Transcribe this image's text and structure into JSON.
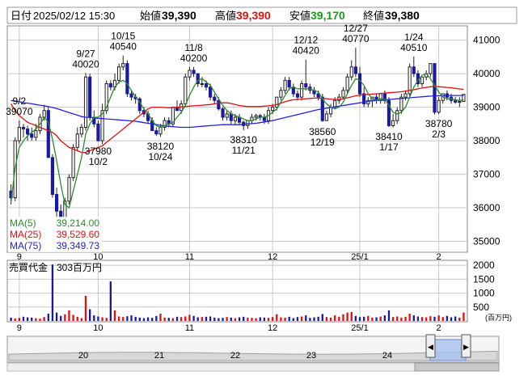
{
  "header": {
    "date_label": "日付",
    "datetime": "2025/02/12 15:30",
    "open_label": "始値",
    "open": "39,390",
    "high_label": "高値",
    "high": "39,390",
    "low_label": "安値",
    "low": "39,170",
    "close_label": "終値",
    "close": "39,380"
  },
  "colors": {
    "up": "#ffffff",
    "down": "#1a1aa0",
    "high_text": "#e01010",
    "low_text": "#1a9a1a",
    "ma5": "#2e8b2e",
    "ma25": "#e01010",
    "ma75": "#2222dd",
    "volume_up": "#e01010",
    "volume_down": "#1a1aa0",
    "grid": "#c8c8c8"
  },
  "legend": {
    "ma5_label": "MA(5)",
    "ma5_value": "39,214.00",
    "ma25_label": "MA(25)",
    "ma25_value": "39,529.60",
    "ma75_label": "MA(75)",
    "ma75_value": "39,349.73"
  },
  "volume_panel": {
    "label": "売買代金",
    "value": "303百万円",
    "unit": "(百万円)"
  },
  "navigator": {
    "labels": [
      "20",
      "21",
      "22",
      "23",
      "24"
    ]
  },
  "chart_data": {
    "type": "candlestick",
    "x": [
      "2024-08-29",
      "2024-08-30",
      "2024-09-02",
      "2024-09-03",
      "2024-09-04",
      "2024-09-05",
      "2024-09-06",
      "2024-09-09",
      "2024-09-10",
      "2024-09-11",
      "2024-09-12",
      "2024-09-13",
      "2024-09-17",
      "2024-09-18",
      "2024-09-19",
      "2024-09-20",
      "2024-09-24",
      "2024-09-25",
      "2024-09-26",
      "2024-09-27",
      "2024-09-30",
      "2024-10-01",
      "2024-10-02",
      "2024-10-03",
      "2024-10-04",
      "2024-10-07",
      "2024-10-08",
      "2024-10-09",
      "2024-10-10",
      "2024-10-11",
      "2024-10-15",
      "2024-10-16",
      "2024-10-17",
      "2024-10-18",
      "2024-10-21",
      "2024-10-22",
      "2024-10-23",
      "2024-10-24",
      "2024-10-25",
      "2024-10-28",
      "2024-10-29",
      "2024-10-30",
      "2024-10-31",
      "2024-11-01",
      "2024-11-05",
      "2024-11-06",
      "2024-11-07",
      "2024-11-08",
      "2024-11-11",
      "2024-11-12",
      "2024-11-13",
      "2024-11-14",
      "2024-11-15",
      "2024-11-18",
      "2024-11-19",
      "2024-11-20",
      "2024-11-21",
      "2024-11-22",
      "2024-11-25",
      "2024-11-26",
      "2024-11-27",
      "2024-11-28",
      "2024-11-29",
      "2024-12-02",
      "2024-12-03",
      "2024-12-04",
      "2024-12-05",
      "2024-12-06",
      "2024-12-09",
      "2024-12-10",
      "2024-12-11",
      "2024-12-12",
      "2024-12-13",
      "2024-12-16",
      "2024-12-17",
      "2024-12-18",
      "2024-12-19",
      "2024-12-20",
      "2024-12-23",
      "2024-12-24",
      "2024-12-25",
      "2024-12-26",
      "2024-12-27",
      "2024-12-30",
      "2025-01-06",
      "2025-01-07",
      "2025-01-08",
      "2025-01-09",
      "2025-01-10",
      "2025-01-14",
      "2025-01-15",
      "2025-01-16",
      "2025-01-17",
      "2025-01-20",
      "2025-01-21",
      "2025-01-22",
      "2025-01-23",
      "2025-01-24",
      "2025-01-27",
      "2025-01-28",
      "2025-01-29",
      "2025-01-30",
      "2025-01-31",
      "2025-02-03",
      "2025-02-04",
      "2025-02-05",
      "2025-02-06",
      "2025-02-07",
      "2025-02-10",
      "2025-02-12"
    ],
    "open": [
      36500,
      36300,
      38000,
      38400,
      38350,
      38200,
      38100,
      38300,
      38700,
      38900,
      37500,
      36400,
      35900,
      35700,
      36200,
      36900,
      37800,
      38200,
      38400,
      39900,
      38700,
      38500,
      38000,
      38900,
      39700,
      39600,
      39800,
      40200,
      40300,
      39400,
      39300,
      39250,
      38900,
      38800,
      38600,
      38300,
      38200,
      38400,
      38600,
      38500,
      39000,
      38900,
      39100,
      39900,
      40100,
      40000,
      39700,
      39700,
      39600,
      39300,
      39200,
      38950,
      38700,
      38800,
      38600,
      38700,
      38550,
      38450,
      38600,
      38700,
      38750,
      38700,
      38600,
      38900,
      39000,
      39300,
      39500,
      39800,
      39600,
      39400,
      39300,
      39700,
      39600,
      39500,
      39400,
      39300,
      38600,
      38800,
      39000,
      39200,
      39300,
      39500,
      39900,
      40200,
      40000,
      39400,
      39100,
      39200,
      39300,
      39200,
      39400,
      39200,
      38450,
      38600,
      38900,
      39300,
      39400,
      40200,
      40000,
      39700,
      39900,
      40000,
      40300,
      38850,
      39200,
      39400,
      39300,
      39200,
      39150,
      39170
    ],
    "high": [
      36700,
      38100,
      38600,
      38500,
      38450,
      38400,
      38500,
      38800,
      39070,
      39000,
      37600,
      36600,
      36100,
      36300,
      37000,
      37900,
      38400,
      38500,
      40020,
      40000,
      38900,
      38600,
      39100,
      39800,
      39800,
      40000,
      40300,
      40540,
      40400,
      39500,
      39400,
      39300,
      39000,
      38900,
      38700,
      38400,
      38500,
      38700,
      38700,
      39000,
      39200,
      39200,
      40000,
      40200,
      40200,
      40000,
      39900,
      39800,
      39700,
      39400,
      39300,
      39000,
      38900,
      38900,
      38800,
      38800,
      38600,
      38600,
      38800,
      38800,
      38800,
      38800,
      39000,
      39100,
      39300,
      39600,
      39900,
      39900,
      39700,
      39500,
      39800,
      40420,
      39700,
      39600,
      39500,
      39400,
      38900,
      39100,
      39300,
      39400,
      39600,
      40000,
      40400,
      40770,
      40200,
      39600,
      39300,
      39300,
      39400,
      39400,
      39500,
      39300,
      38800,
      39000,
      39400,
      39500,
      40300,
      40510,
      40100,
      39900,
      40100,
      40200,
      40300,
      39300,
      39300,
      39500,
      39400,
      39300,
      39300,
      39390
    ],
    "low": [
      36100,
      36200,
      37900,
      38100,
      38000,
      38000,
      38000,
      38200,
      38600,
      37500,
      36300,
      35700,
      35600,
      35600,
      36100,
      36800,
      37700,
      38100,
      38300,
      38600,
      38400,
      37980,
      37900,
      38800,
      39500,
      39500,
      39700,
      40100,
      39300,
      39200,
      39100,
      38800,
      38700,
      38500,
      38300,
      38150,
      38120,
      38300,
      38400,
      38400,
      38900,
      38800,
      39000,
      39800,
      39900,
      39600,
      39600,
      39500,
      39200,
      39100,
      38900,
      38600,
      38600,
      38500,
      38500,
      38500,
      38310,
      38350,
      38500,
      38600,
      38600,
      38500,
      38500,
      38800,
      38900,
      39200,
      39400,
      39500,
      39300,
      39200,
      39200,
      39500,
      39400,
      39300,
      39200,
      38560,
      38600,
      38700,
      38950,
      39100,
      39250,
      39400,
      39800,
      39900,
      39300,
      39000,
      39000,
      39000,
      39100,
      39100,
      39100,
      38410,
      38400,
      38500,
      38800,
      39200,
      39300,
      39900,
      39600,
      39600,
      39800,
      39900,
      38780,
      38800,
      39100,
      39200,
      39100,
      39100,
      39000,
      39170
    ],
    "close": [
      36300,
      38000,
      38400,
      38350,
      38200,
      38100,
      38300,
      38700,
      38900,
      37500,
      36400,
      35900,
      35700,
      36200,
      36900,
      37800,
      38200,
      38400,
      39900,
      38700,
      38500,
      38000,
      38900,
      39700,
      39600,
      39800,
      40200,
      40300,
      39400,
      39300,
      39250,
      38900,
      38800,
      38600,
      38300,
      38200,
      38400,
      38600,
      38500,
      39000,
      38900,
      39100,
      39900,
      40100,
      40000,
      39700,
      39700,
      39600,
      39300,
      39200,
      38950,
      38700,
      38800,
      38600,
      38700,
      38550,
      38450,
      38600,
      38700,
      38750,
      38700,
      38600,
      38900,
      39000,
      39300,
      39500,
      39800,
      39600,
      39400,
      39300,
      39700,
      39600,
      39500,
      39400,
      39300,
      38600,
      38800,
      39000,
      39200,
      39300,
      39500,
      39900,
      40200,
      40000,
      39400,
      39100,
      39200,
      39300,
      39200,
      39400,
      39200,
      38450,
      38600,
      38900,
      39300,
      39400,
      40200,
      40000,
      39700,
      39900,
      40000,
      40300,
      38850,
      39200,
      39400,
      39300,
      39200,
      39150,
      39170,
      39380
    ],
    "volume": [
      120,
      90,
      110,
      150,
      130,
      120,
      100,
      80,
      140,
      260,
      2030,
      300,
      180,
      240,
      380,
      220,
      150,
      100,
      900,
      420,
      200,
      160,
      130,
      110,
      1420,
      380,
      160,
      140,
      170,
      200,
      150,
      120,
      100,
      130,
      110,
      180,
      260,
      120,
      110,
      100,
      150,
      140,
      160,
      220,
      180,
      130,
      140,
      150,
      160,
      120,
      100,
      110,
      140,
      120,
      100,
      130,
      150,
      120,
      110,
      100,
      130,
      120,
      110,
      140,
      240,
      130,
      120,
      150,
      100,
      140,
      160,
      200,
      110,
      130,
      150,
      250,
      140,
      120,
      200,
      150,
      240,
      300,
      320,
      180,
      140,
      150,
      180,
      120,
      130,
      160,
      200,
      380,
      140,
      160,
      120,
      150,
      260,
      200,
      160,
      140,
      130,
      170,
      150,
      200,
      140,
      180,
      130,
      160,
      120,
      303
    ],
    "ma5": [
      36150,
      37200,
      37800,
      38000,
      38150,
      38250,
      38350,
      38500,
      38700,
      38550,
      38050,
      37400,
      36700,
      36100,
      36000,
      36500,
      37000,
      37500,
      38200,
      38500,
      38700,
      38700,
      38800,
      39000,
      39300,
      39600,
      39750,
      39800,
      39700,
      39500,
      39300,
      39150,
      38950,
      38800,
      38600,
      38450,
      38400,
      38450,
      38500,
      38550,
      38700,
      38850,
      39050,
      39350,
      39600,
      39800,
      39850,
      39750,
      39650,
      39450,
      39250,
      39050,
      38900,
      38800,
      38750,
      38700,
      38650,
      38600,
      38600,
      38650,
      38700,
      38700,
      38750,
      38850,
      38950,
      39150,
      39350,
      39550,
      39600,
      39550,
      39550,
      39550,
      39550,
      39500,
      39450,
      39250,
      39100,
      39000,
      38950,
      39000,
      39150,
      39400,
      39650,
      39850,
      39800,
      39650,
      39400,
      39250,
      39200,
      39250,
      39250,
      39050,
      38850,
      38800,
      38850,
      39000,
      39300,
      39600,
      39800,
      39950,
      40000,
      39850,
      39650,
      39450,
      39300,
      39250,
      39250,
      39220,
      39200,
      39214
    ],
    "ma25": [
      39100,
      38900,
      38750,
      38650,
      38550,
      38500,
      38450,
      38400,
      38350,
      38300,
      38250,
      38150,
      38000,
      37900,
      37800,
      37750,
      37700,
      37650,
      37650,
      37700,
      37750,
      37800,
      37850,
      37950,
      38050,
      38150,
      38250,
      38350,
      38450,
      38550,
      38650,
      38750,
      38850,
      38950,
      39000,
      39000,
      39000,
      38990,
      38980,
      38990,
      39000,
      39010,
      39020,
      39030,
      39040,
      39050,
      39060,
      39070,
      39080,
      39100,
      39120,
      39130,
      39130,
      39110,
      39080,
      39050,
      39030,
      39020,
      39020,
      39020,
      39020,
      39030,
      39040,
      39050,
      39080,
      39120,
      39160,
      39200,
      39220,
      39230,
      39240,
      39250,
      39260,
      39270,
      39270,
      39260,
      39250,
      39240,
      39230,
      39230,
      39250,
      39280,
      39310,
      39340,
      39360,
      39370,
      39380,
      39390,
      39400,
      39410,
      39420,
      39430,
      39440,
      39450,
      39460,
      39480,
      39500,
      39520,
      39550,
      39570,
      39590,
      39610,
      39620,
      39610,
      39600,
      39590,
      39580,
      39560,
      39545,
      39530
    ],
    "ma75": [
      39200,
      39180,
      39160,
      39140,
      39120,
      39100,
      39080,
      39060,
      39040,
      39020,
      38990,
      38960,
      38920,
      38880,
      38840,
      38800,
      38760,
      38720,
      38700,
      38690,
      38680,
      38670,
      38660,
      38650,
      38640,
      38630,
      38620,
      38610,
      38600,
      38590,
      38580,
      38560,
      38540,
      38520,
      38500,
      38480,
      38460,
      38440,
      38430,
      38420,
      38410,
      38400,
      38400,
      38400,
      38410,
      38420,
      38430,
      38440,
      38450,
      38460,
      38470,
      38480,
      38480,
      38480,
      38480,
      38480,
      38490,
      38500,
      38510,
      38520,
      38540,
      38560,
      38580,
      38600,
      38630,
      38660,
      38690,
      38720,
      38750,
      38780,
      38810,
      38840,
      38870,
      38900,
      38930,
      38950,
      38970,
      38990,
      39010,
      39030,
      39050,
      39070,
      39090,
      39110,
      39130,
      39150,
      39170,
      39190,
      39200,
      39210,
      39220,
      39230,
      39240,
      39250,
      39260,
      39270,
      39280,
      39290,
      39300,
      39310,
      39320,
      39330,
      39340,
      39340,
      39345,
      39348,
      39350,
      39350,
      39350,
      39349.73
    ],
    "annotations": [
      {
        "x": "2024-09-02",
        "date": "9/2",
        "value": "39070",
        "position": "above"
      },
      {
        "x": "2024-09-26",
        "date": "9/27",
        "value": "40020",
        "position": "above"
      },
      {
        "x": "2024-10-01",
        "date": "10/2",
        "value": "37980",
        "position": "below"
      },
      {
        "x": "2024-10-09",
        "date": "10/15",
        "value": "40540",
        "position": "above"
      },
      {
        "x": "2024-10-23",
        "date": "10/24",
        "value": "38120",
        "position": "below"
      },
      {
        "x": "2024-11-05",
        "date": "11/8",
        "value": "40200",
        "position": "above"
      },
      {
        "x": "2024-11-21",
        "date": "11/21",
        "value": "38310",
        "position": "below"
      },
      {
        "x": "2024-12-12",
        "date": "12/12",
        "value": "40420",
        "position": "above"
      },
      {
        "x": "2024-12-18",
        "date": "12/19",
        "value": "38560",
        "position": "below"
      },
      {
        "x": "2024-12-30",
        "date": "12/27",
        "value": "40770",
        "position": "above"
      },
      {
        "x": "2025-01-16",
        "date": "1/17",
        "value": "38410",
        "position": "below"
      },
      {
        "x": "2025-01-24",
        "date": "1/24",
        "value": "40510",
        "position": "above"
      },
      {
        "x": "2025-02-03",
        "date": "2/3",
        "value": "38780",
        "position": "below"
      }
    ],
    "x_tick_labels": [
      {
        "x": "2024-09-02",
        "label": "9"
      },
      {
        "x": "2024-10-01",
        "label": "10"
      },
      {
        "x": "2024-11-01",
        "label": "11"
      },
      {
        "x": "2024-12-02",
        "label": "12"
      },
      {
        "x": "2025-01-06",
        "label": "25/1"
      },
      {
        "x": "2025-02-03",
        "label": "2"
      }
    ],
    "y_ticks": [
      35000,
      36000,
      37000,
      38000,
      39000,
      40000,
      41000
    ],
    "ylim": [
      34700,
      41400
    ],
    "volume_ticks": [
      500,
      1000,
      1500,
      2000
    ],
    "volume_ylim": [
      0,
      2150
    ],
    "grid": true
  }
}
